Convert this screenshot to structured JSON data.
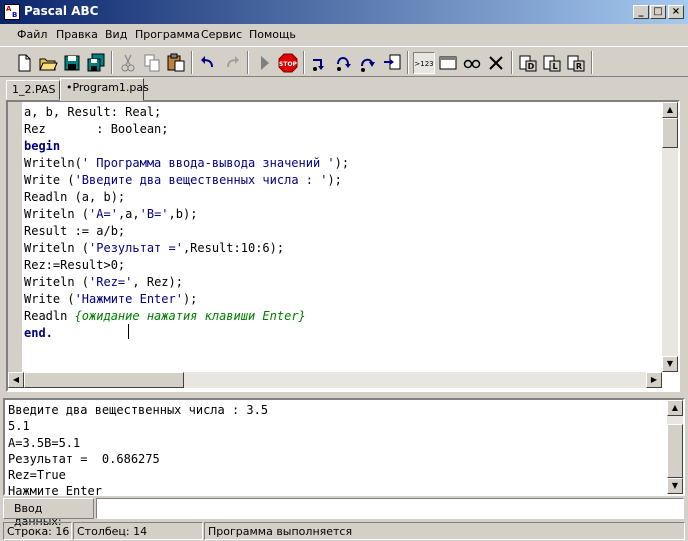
{
  "window": {
    "title": "Pascal ABC"
  },
  "menu": [
    "Файл",
    "Правка",
    "Вид",
    "Программа",
    "Сервис",
    "Помощь"
  ],
  "toolbar": {
    "icons": [
      "new-file-icon",
      "open-folder-icon",
      "save-icon",
      "save-all-icon",
      "cut-icon",
      "copy-icon",
      "paste-icon",
      "undo-icon",
      "redo-icon",
      "run-icon",
      "stop-icon",
      "step-into-icon",
      "step-over-icon",
      "step-out-icon",
      "run-to-cursor-icon",
      "watch-icon",
      "window-icon",
      "glasses-icon",
      "close-x-icon",
      "doc-d-icon",
      "doc-l-icon",
      "doc-r-icon"
    ],
    "output_toggle_label": ">123"
  },
  "tabs": [
    {
      "label": "1_2.PAS"
    },
    {
      "label": "•Program1.pas",
      "active": true
    }
  ],
  "editor": {
    "lines": [
      [
        {
          "t": "a, b, Result: Real;"
        }
      ],
      [
        {
          "t": "Rez       : Boolean;"
        }
      ],
      [
        {
          "t": "begin",
          "k": "kw"
        }
      ],
      [
        {
          "t": "Writeln("
        },
        {
          "t": "' Программа ввода-вывода значений '",
          "k": "str"
        },
        {
          "t": ");"
        }
      ],
      [
        {
          "t": "Write ("
        },
        {
          "t": "'Введите два вещественных числа : '",
          "k": "str"
        },
        {
          "t": ");"
        }
      ],
      [
        {
          "t": "Readln (a, b);"
        }
      ],
      [
        {
          "t": "Writeln ("
        },
        {
          "t": "'A='",
          "k": "str"
        },
        {
          "t": ",a,"
        },
        {
          "t": "'B='",
          "k": "str"
        },
        {
          "t": ",b);"
        }
      ],
      [
        {
          "t": "Result := a/b;"
        }
      ],
      [
        {
          "t": "Writeln ("
        },
        {
          "t": "'Результат ='",
          "k": "str"
        },
        {
          "t": ",Result:10:6);"
        }
      ],
      [
        {
          "t": "Rez:=Result>0;"
        }
      ],
      [
        {
          "t": "Writeln ("
        },
        {
          "t": "'Rez='",
          "k": "str"
        },
        {
          "t": ", Rez);"
        }
      ],
      [
        {
          "t": "Write ("
        },
        {
          "t": "'Нажмите Enter'",
          "k": "str"
        },
        {
          "t": ");"
        }
      ],
      [
        {
          "t": "Readln "
        },
        {
          "t": "{ожидание нажатия клавиши Enter}",
          "k": "cmt"
        }
      ],
      [
        {
          "t": "end.",
          "k": "kw"
        }
      ]
    ]
  },
  "output": {
    "lines": [
      "Введите два вещественных числа : 3.5",
      "5.1",
      "A=3.5B=5.1",
      "Результат =  0.686275",
      "Rez=True",
      "Нажмите Enter"
    ]
  },
  "input": {
    "label": "Ввод данных:",
    "value": ""
  },
  "status": {
    "line": "Строка: 16",
    "column": "Столбец: 14",
    "message": "Программа выполняется"
  }
}
